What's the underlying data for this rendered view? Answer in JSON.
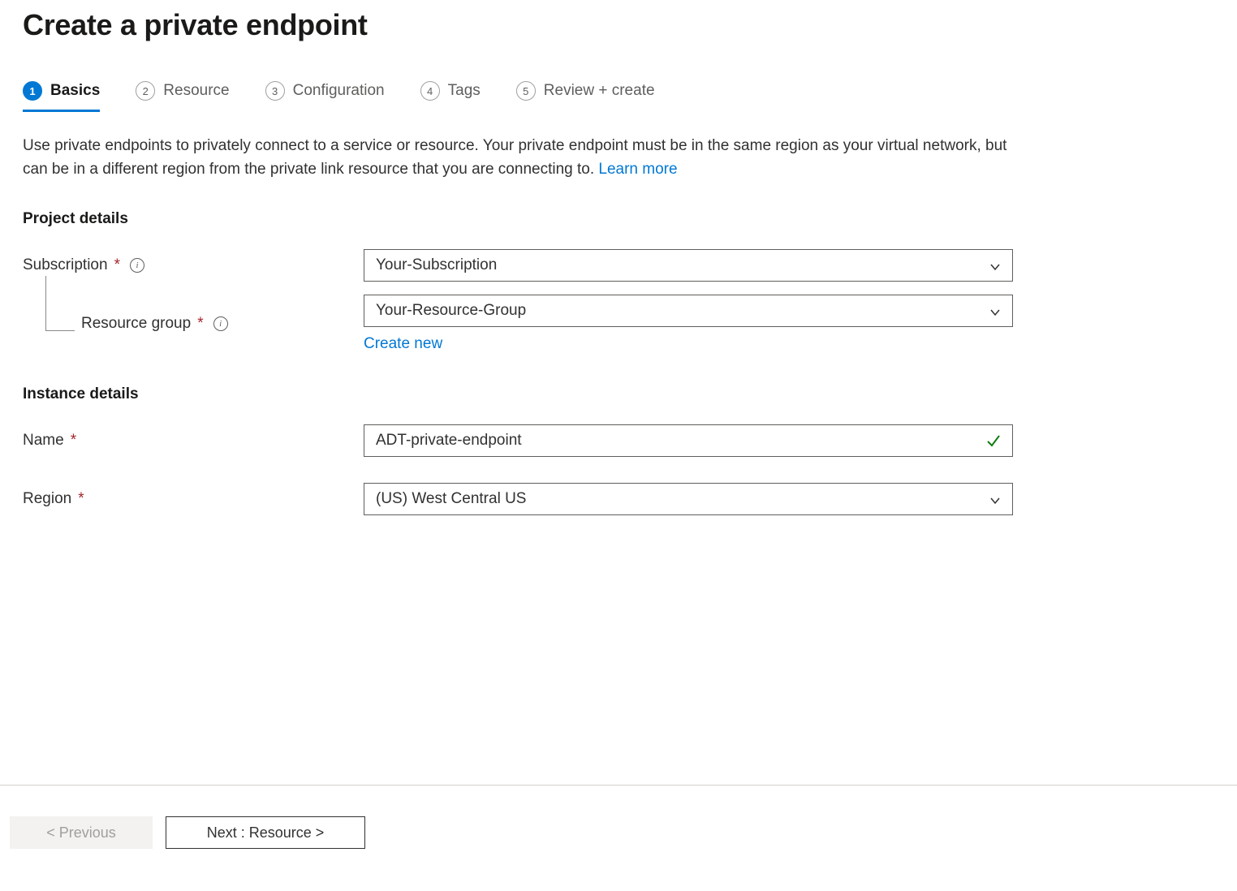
{
  "page": {
    "title": "Create a private endpoint"
  },
  "tabs": [
    {
      "number": "1",
      "label": "Basics"
    },
    {
      "number": "2",
      "label": "Resource"
    },
    {
      "number": "3",
      "label": "Configuration"
    },
    {
      "number": "4",
      "label": "Tags"
    },
    {
      "number": "5",
      "label": "Review + create"
    }
  ],
  "description": {
    "text": "Use private endpoints to privately connect to a service or resource. Your private endpoint must be in the same region as your virtual network, but can be in a different region from the private link resource that you are connecting to.  ",
    "learn_more": "Learn more"
  },
  "sections": {
    "project_details": "Project details",
    "instance_details": "Instance details"
  },
  "fields": {
    "subscription": {
      "label": "Subscription",
      "value": "Your-Subscription"
    },
    "resource_group": {
      "label": "Resource group",
      "value": "Your-Resource-Group",
      "create_new": "Create new"
    },
    "name": {
      "label": "Name",
      "value": "ADT-private-endpoint"
    },
    "region": {
      "label": "Region",
      "value": "(US) West Central US"
    }
  },
  "footer": {
    "previous": "< Previous",
    "next": "Next : Resource >"
  }
}
